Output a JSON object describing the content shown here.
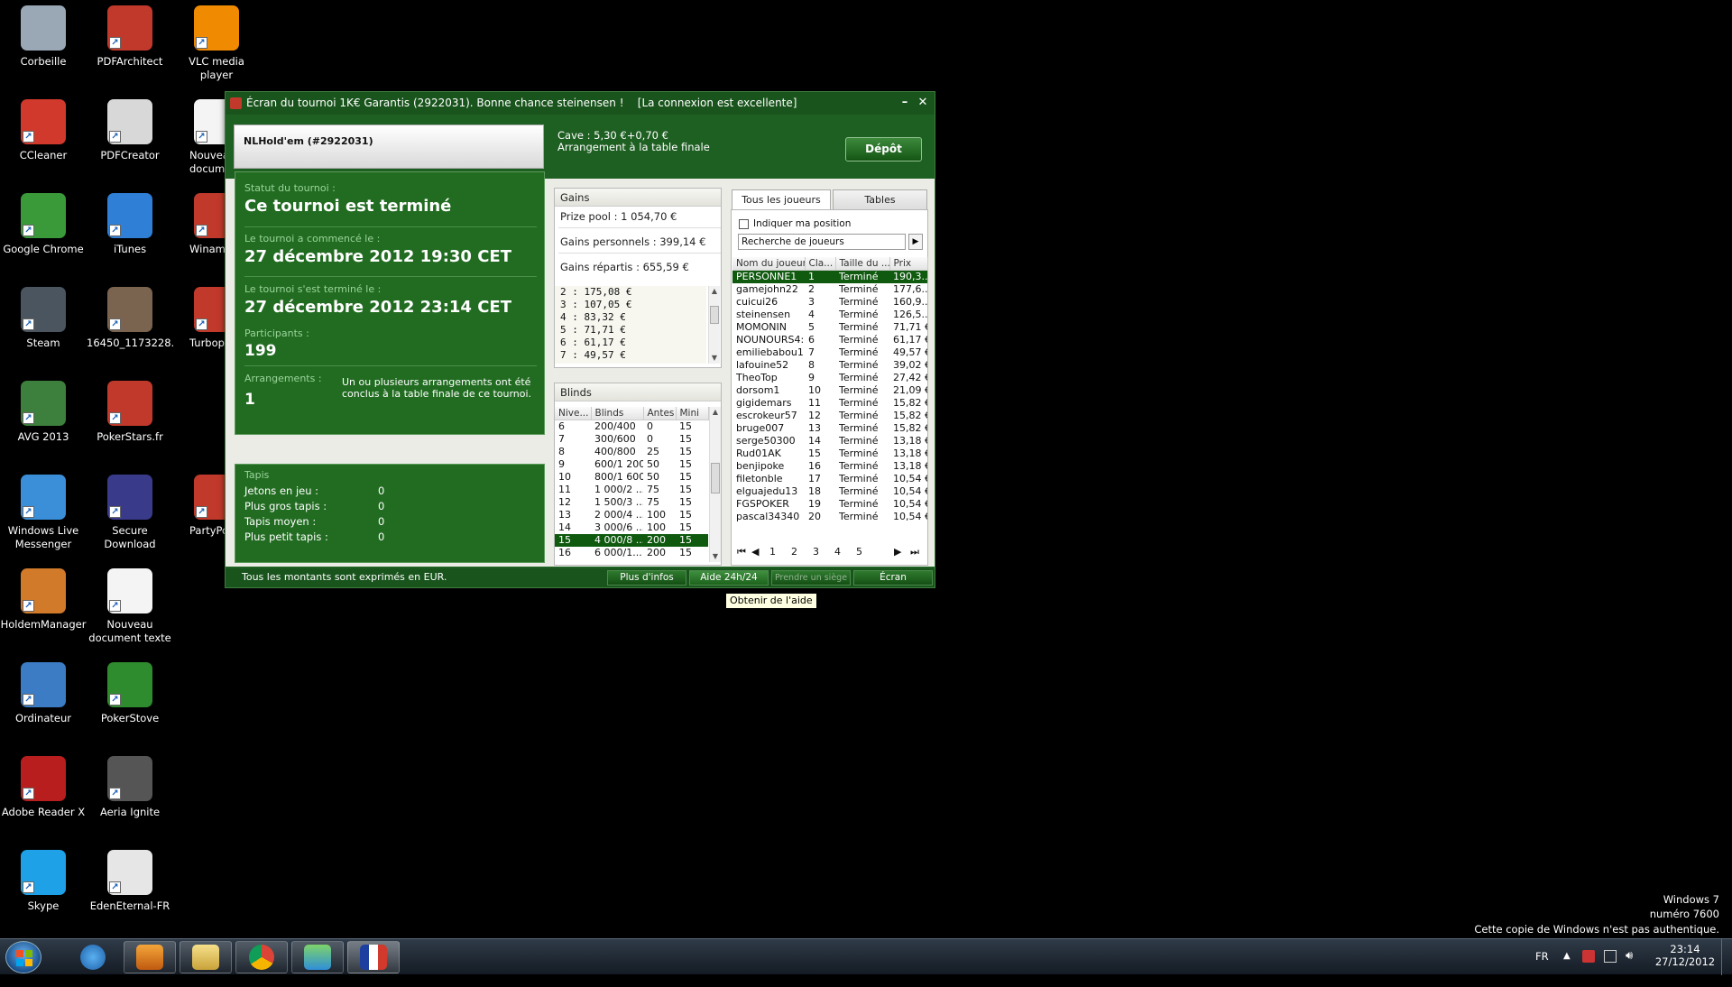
{
  "desktop": {
    "icons": [
      {
        "label": "Corbeille",
        "icon": "recycle-bin-icon",
        "color": "#9aa8b5"
      },
      {
        "label": "PDFArchitect",
        "icon": "pdf-architect-icon",
        "color": "#c0392b"
      },
      {
        "label": "VLC media player",
        "icon": "vlc-icon",
        "color": "#f08a00"
      },
      {
        "label": "CCleaner",
        "icon": "ccleaner-icon",
        "color": "#d0392b"
      },
      {
        "label": "PDFCreator",
        "icon": "pdfcreator-icon",
        "color": "#d8d8d8"
      },
      {
        "label": "Nouveau document",
        "icon": "text-document-icon",
        "color": "#f4f4f4"
      },
      {
        "label": "Google Chrome",
        "icon": "chrome-icon",
        "color": "#3a9a3a"
      },
      {
        "label": "iTunes",
        "icon": "itunes-icon",
        "color": "#2f7fd6"
      },
      {
        "label": "Winamax",
        "icon": "winamax-icon",
        "color": "#c0392b"
      },
      {
        "label": "Steam",
        "icon": "steam-icon",
        "color": "#4a5560"
      },
      {
        "label": "16450_1173228...",
        "icon": "photo-file-icon",
        "color": "#7a6450"
      },
      {
        "label": "Turbopoker",
        "icon": "turbopoker-icon",
        "color": "#c0392b"
      },
      {
        "label": "AVG 2013",
        "icon": "avg-icon",
        "color": "#3d7f3d"
      },
      {
        "label": "PokerStars.fr",
        "icon": "pokerstars-icon",
        "color": "#c0392b"
      },
      {
        "label": "Windows Live Messenger",
        "icon": "messenger-icon",
        "color": "#3b8fd8"
      },
      {
        "label": "Secure Download Manager",
        "icon": "download-manager-icon",
        "color": "#3a3a8a"
      },
      {
        "label": "PartyPoker",
        "icon": "partypoker-icon",
        "color": "#c0392b"
      },
      {
        "label": "HoldemManager",
        "icon": "holdem-manager-icon",
        "color": "#d07a2a"
      },
      {
        "label": "Nouveau document texte",
        "icon": "text-document-icon",
        "color": "#f4f4f4"
      },
      {
        "label": "Ordinateur",
        "icon": "computer-icon",
        "color": "#3b7cc4"
      },
      {
        "label": "PokerStove",
        "icon": "pokerstove-icon",
        "color": "#2e8b2e"
      },
      {
        "label": "Adobe Reader X",
        "icon": "adobe-reader-icon",
        "color": "#b81e1e"
      },
      {
        "label": "Aeria Ignite",
        "icon": "aeria-ignite-icon",
        "color": "#555555"
      },
      {
        "label": "Skype",
        "icon": "skype-icon",
        "color": "#1ea1e6"
      },
      {
        "label": "EdenEternal-FR",
        "icon": "eden-eternal-icon",
        "color": "#e6e6e6"
      }
    ],
    "license": {
      "line1": "Windows 7",
      "line2": "numéro 7600",
      "line3": "Cette copie de Windows n'est pas authentique."
    }
  },
  "window": {
    "title": "Écran du tournoi 1K€ Garantis (2922031). Bonne chance steinensen !    [La connexion est excellente]",
    "minimize": "–",
    "close": "✕",
    "game_title": "NLHold'em (#2922031)",
    "cave": "Cave : 5,30 €+0,70 €",
    "arrangement": "Arrangement à la table finale",
    "depot": "Dépôt"
  },
  "status": {
    "statut_label": "Statut du tournoi :",
    "statut_value": "Ce tournoi est terminé",
    "start_label": "Le tournoi a commencé le :",
    "start_value": "27 décembre 2012  19:30 CET",
    "end_label": "Le tournoi s'est terminé le :",
    "end_value": "27 décembre 2012  23:14 CET",
    "participants_label": "Participants :",
    "participants_value": "199",
    "arrangements_label": "Arrangements :",
    "arrangements_value": "1",
    "arrangements_note": "Un ou plusieurs arrangements ont été conclus à la table finale de ce tournoi."
  },
  "tapis": {
    "title": "Tapis",
    "rows": [
      {
        "label": "Jetons en jeu :",
        "value": "0"
      },
      {
        "label": "Plus gros tapis :",
        "value": "0"
      },
      {
        "label": "Tapis moyen :",
        "value": "0"
      },
      {
        "label": "Plus petit tapis :",
        "value": "0"
      }
    ]
  },
  "gains": {
    "title": "Gains",
    "prize_pool": "Prize pool : 1 054,70 €",
    "personal": "Gains personnels : 399,14 €",
    "distributed": "Gains répartis : 655,59 €",
    "list": [
      "2 : 175,08 €",
      "3 : 107,05 €",
      "4 : 83,32 €",
      "5 : 71,71 €",
      "6 : 61,17 €",
      "7 : 49,57 €"
    ]
  },
  "blinds": {
    "title": "Blinds",
    "headers": [
      "Nive...",
      "Blinds",
      "Antes",
      "Mini"
    ],
    "rows": [
      [
        "6",
        "200/400",
        "0",
        "15"
      ],
      [
        "7",
        "300/600",
        "0",
        "15"
      ],
      [
        "8",
        "400/800",
        "25",
        "15"
      ],
      [
        "9",
        "600/1 200",
        "50",
        "15"
      ],
      [
        "10",
        "800/1 600",
        "50",
        "15"
      ],
      [
        "11",
        "1 000/2 ...",
        "75",
        "15"
      ],
      [
        "12",
        "1 500/3 ...",
        "75",
        "15"
      ],
      [
        "13",
        "2 000/4 ...",
        "100",
        "15"
      ],
      [
        "14",
        "3 000/6 ...",
        "100",
        "15"
      ],
      [
        "15",
        "4 000/8 ...",
        "200",
        "15"
      ],
      [
        "16",
        "6 000/1...",
        "200",
        "15"
      ]
    ]
  },
  "players": {
    "tab_all": "Tous les joueurs",
    "tab_tables": "Tables",
    "show_position": "Indiquer ma position",
    "search_placeholder": "Recherche de joueurs",
    "headers": [
      "Nom du joueur",
      "Cla...",
      "Taille du ...",
      "Prix"
    ],
    "rows": [
      [
        "PERSONNE1",
        "1",
        "Terminé",
        "190,3..."
      ],
      [
        "gamejohn22",
        "2",
        "Terminé",
        "177,6..."
      ],
      [
        "cuicui26",
        "3",
        "Terminé",
        "160,9..."
      ],
      [
        "steinensen",
        "4",
        "Terminé",
        "126,5..."
      ],
      [
        "MOMONIN",
        "5",
        "Terminé",
        "71,71 €"
      ],
      [
        "NOUNOURS4:",
        "6",
        "Terminé",
        "61,17 €"
      ],
      [
        "emiliebabou1",
        "7",
        "Terminé",
        "49,57 €"
      ],
      [
        "lafouine52",
        "8",
        "Terminé",
        "39,02 €"
      ],
      [
        "TheoTop",
        "9",
        "Terminé",
        "27,42 €"
      ],
      [
        "dorsom1",
        "10",
        "Terminé",
        "21,09 €"
      ],
      [
        "gigidemars",
        "11",
        "Terminé",
        "15,82 €"
      ],
      [
        "escrokeur57",
        "12",
        "Terminé",
        "15,82 €"
      ],
      [
        "bruge007",
        "13",
        "Terminé",
        "15,82 €"
      ],
      [
        "serge50300",
        "14",
        "Terminé",
        "13,18 €"
      ],
      [
        "Rud01AK",
        "15",
        "Terminé",
        "13,18 €"
      ],
      [
        "benjipoke",
        "16",
        "Terminé",
        "13,18 €"
      ],
      [
        "filetonble",
        "17",
        "Terminé",
        "10,54 €"
      ],
      [
        "elguajedu13",
        "18",
        "Terminé",
        "10,54 €"
      ],
      [
        "FGSPOKER",
        "19",
        "Terminé",
        "10,54 €"
      ],
      [
        "pascal34340",
        "20",
        "Terminé",
        "10,54 €"
      ]
    ],
    "pages": [
      "1",
      "2",
      "3",
      "4",
      "5"
    ]
  },
  "bottom": {
    "currency_note": "Tous les montants sont exprimés en EUR.",
    "more_info": "Plus d'infos",
    "help": "Aide 24h/24",
    "take_seat": "Prendre un siège",
    "screen": "Écran",
    "tooltip": "Obtenir de l'aide"
  },
  "taskbar": {
    "language": "FR",
    "time": "23:14",
    "date": "27/12/2012"
  }
}
